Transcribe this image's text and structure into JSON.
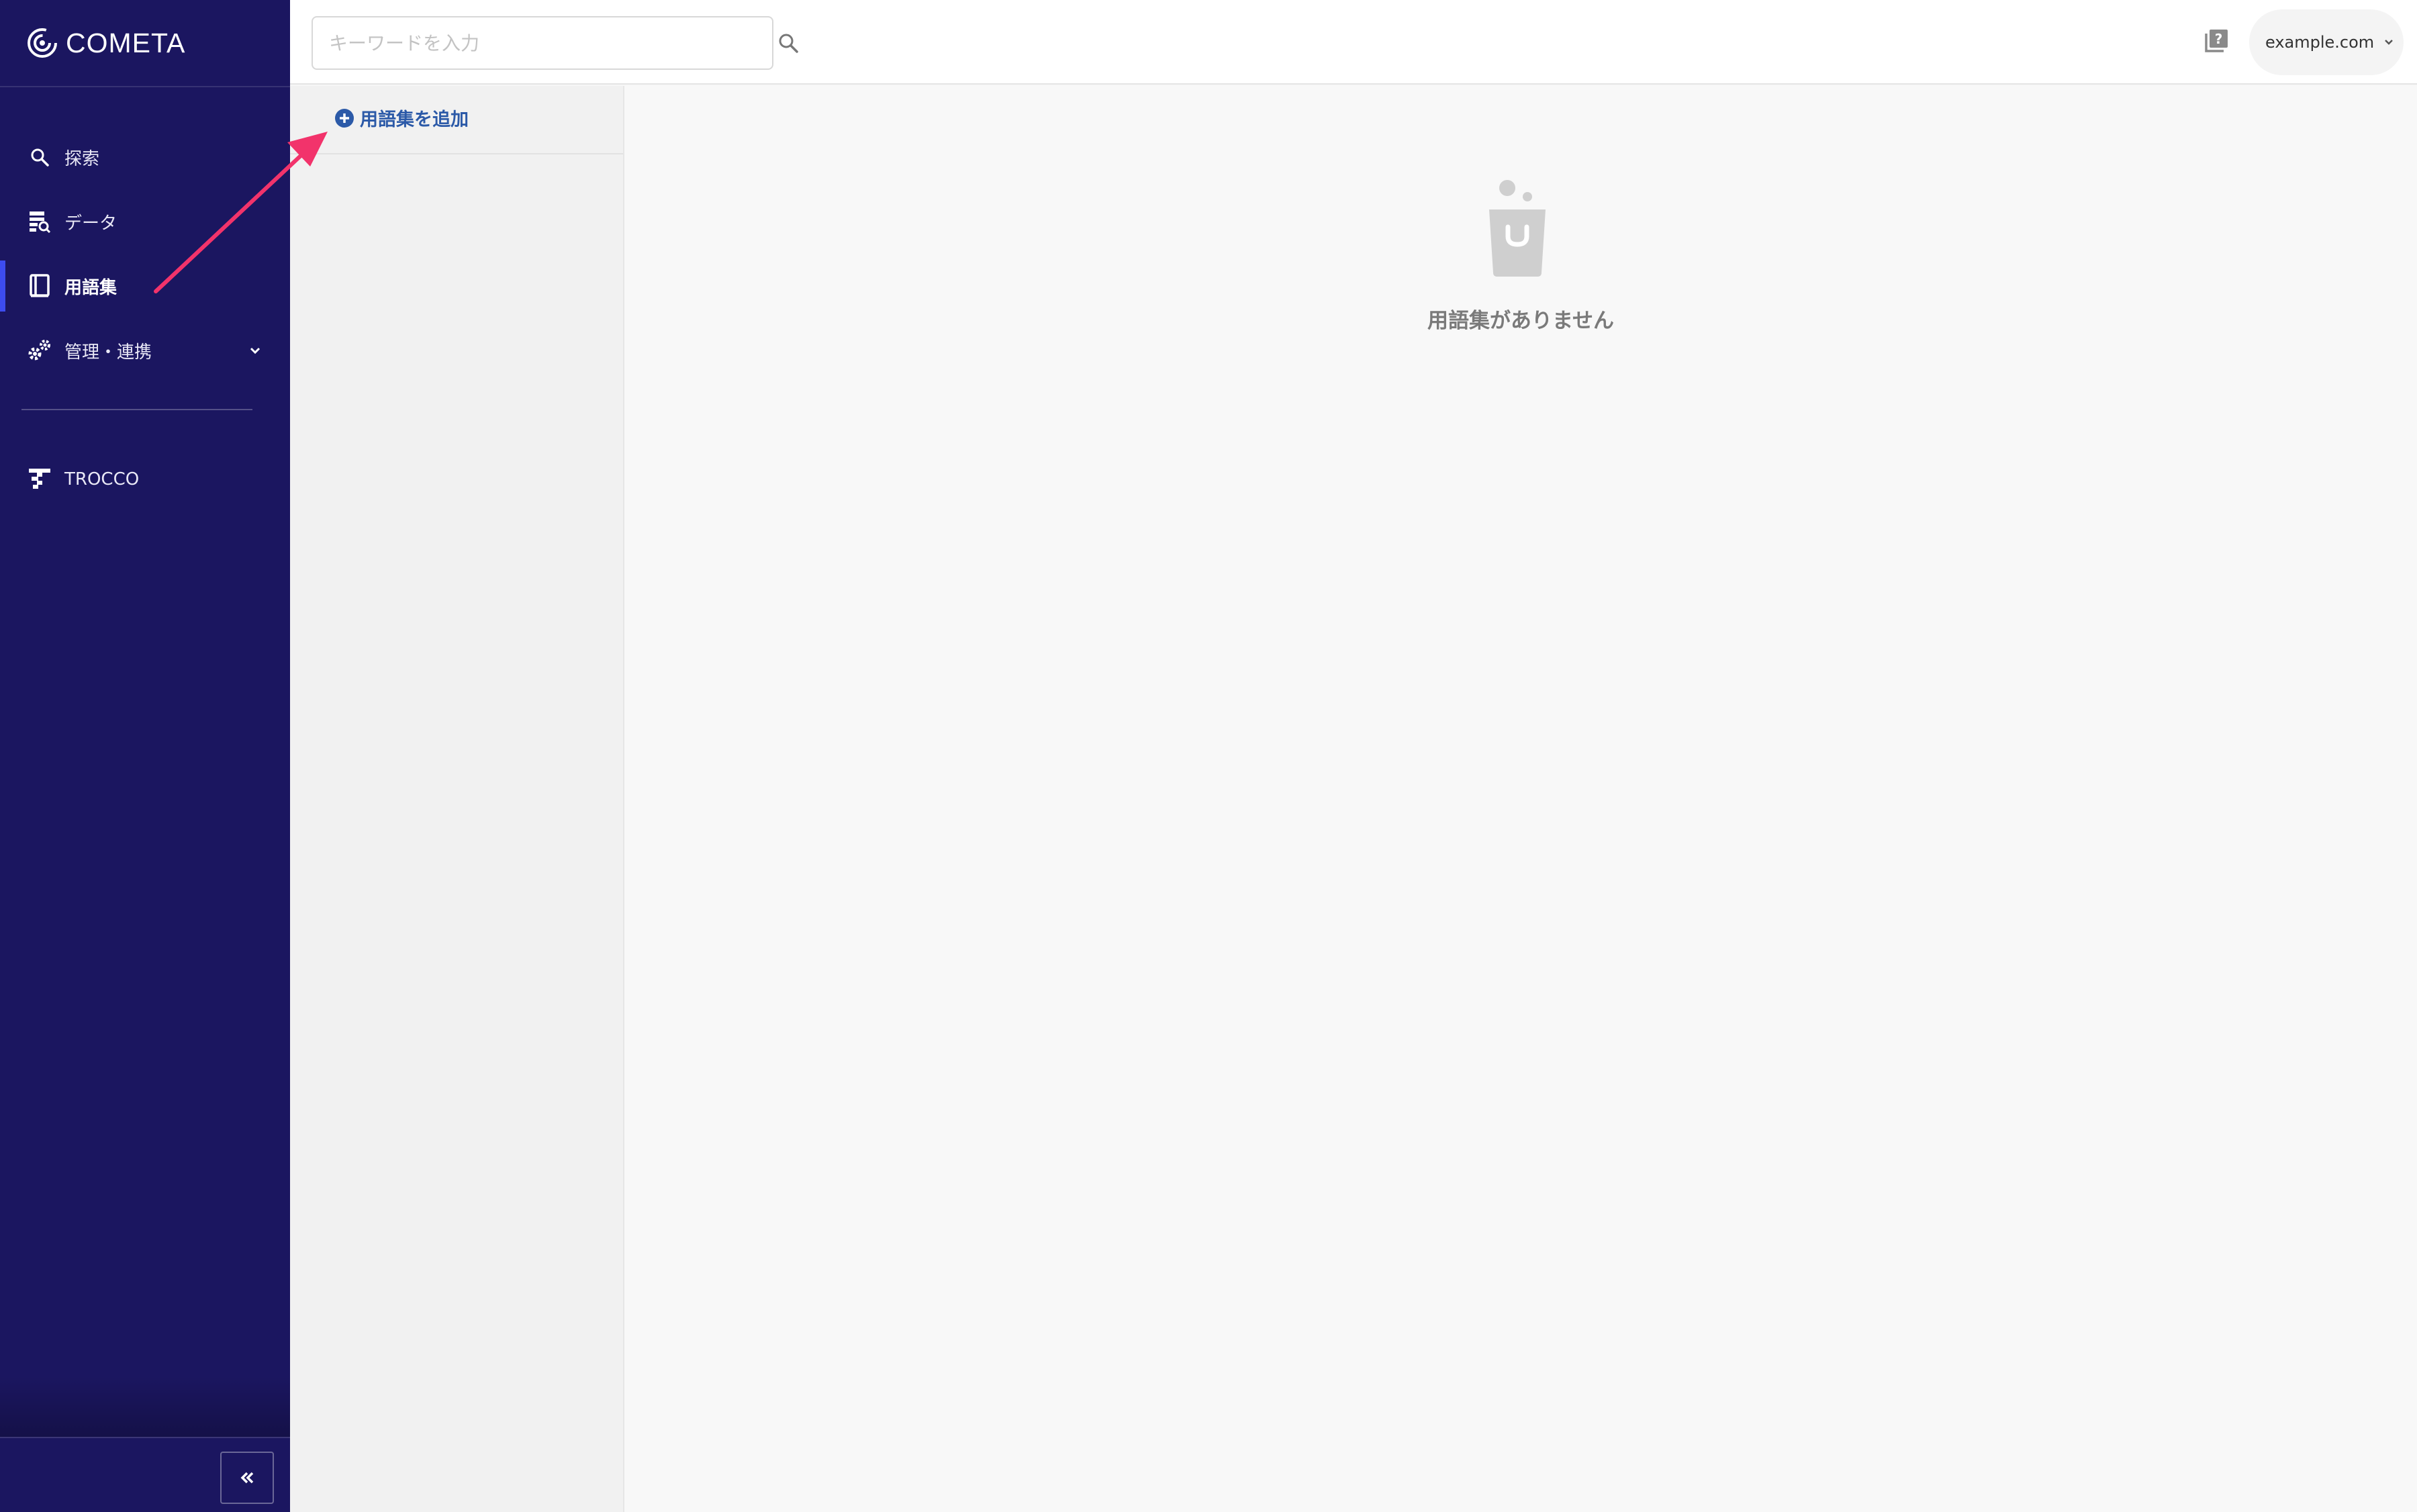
{
  "app": {
    "brand": "COMETA"
  },
  "sidebar": {
    "items": [
      {
        "label": "探索",
        "icon": "search-icon"
      },
      {
        "label": "データ",
        "icon": "data-catalog-icon"
      },
      {
        "label": "用語集",
        "icon": "book-icon",
        "active": true
      },
      {
        "label": "管理・連携",
        "icon": "gears-icon",
        "expandable": true
      }
    ],
    "external": [
      {
        "label": "TROCCO",
        "icon": "trocco-icon"
      }
    ],
    "collapse_icon": "double-chevron-left-icon"
  },
  "header": {
    "search": {
      "placeholder": "キーワードを入力",
      "value": ""
    },
    "help_icon": "help-book-icon",
    "account": {
      "label": "example.com"
    }
  },
  "glossary_panel": {
    "add_label": "用語集を追加"
  },
  "main": {
    "empty_message": "用語集がありません"
  },
  "colors": {
    "sidebar_bg": "#1b1660",
    "active_indicator": "#3d4cf0",
    "link_blue": "#2c5aa8",
    "annotation_arrow": "#f2336b"
  }
}
